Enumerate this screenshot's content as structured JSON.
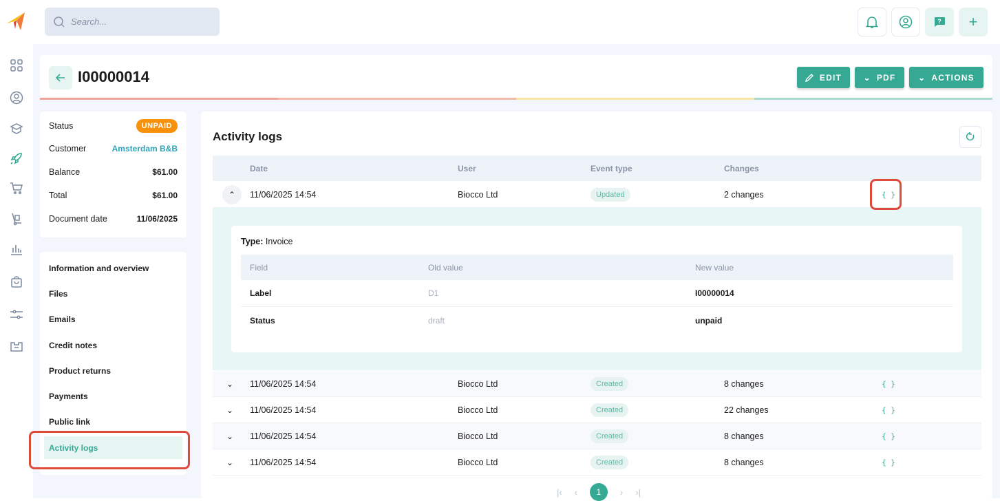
{
  "search": {
    "placeholder": "Search..."
  },
  "header": {
    "title": "I00000014",
    "buttons": {
      "edit": "EDIT",
      "pdf": "PDF",
      "actions": "ACTIONS"
    },
    "colors": {
      "accent": "#36a994",
      "bar_red": "#f2a49a",
      "bar_yellow": "#fbe3a2",
      "bar_green": "#a8dccf"
    }
  },
  "info": {
    "rows": [
      {
        "label": "Status",
        "value": "UNPAID"
      },
      {
        "label": "Customer",
        "value": "Amsterdam B&B"
      },
      {
        "label": "Balance",
        "value": "$61.00"
      },
      {
        "label": "Total",
        "value": "$61.00"
      },
      {
        "label": "Document date",
        "value": "11/06/2025"
      }
    ]
  },
  "nav": {
    "items": [
      "Information and overview",
      "Files",
      "Emails",
      "Credit notes",
      "Product returns",
      "Payments",
      "Public link",
      "Activity logs"
    ],
    "active": "Activity logs"
  },
  "main": {
    "title": "Activity logs",
    "columns": [
      "Date",
      "User",
      "Event type",
      "Changes"
    ],
    "rows": [
      {
        "date": "11/06/2025 14:54",
        "user": "Biocco Ltd",
        "event": "Updated",
        "changes": "2 changes",
        "expanded": true
      },
      {
        "date": "11/06/2025 14:54",
        "user": "Biocco Ltd",
        "event": "Created",
        "changes": "8 changes"
      },
      {
        "date": "11/06/2025 14:54",
        "user": "Biocco Ltd",
        "event": "Created",
        "changes": "22 changes"
      },
      {
        "date": "11/06/2025 14:54",
        "user": "Biocco Ltd",
        "event": "Created",
        "changes": "8 changes"
      },
      {
        "date": "11/06/2025 14:54",
        "user": "Biocco Ltd",
        "event": "Created",
        "changes": "8 changes"
      }
    ],
    "json_label": "{ }",
    "detail": {
      "type_label": "Type:",
      "type_value": "Invoice",
      "columns": [
        "Field",
        "Old value",
        "New value"
      ],
      "rows": [
        {
          "field": "Label",
          "old": "D1",
          "new": "I00000014"
        },
        {
          "field": "Status",
          "old": "draft",
          "new": "unpaid"
        }
      ]
    },
    "pagination": {
      "current": "1"
    }
  }
}
